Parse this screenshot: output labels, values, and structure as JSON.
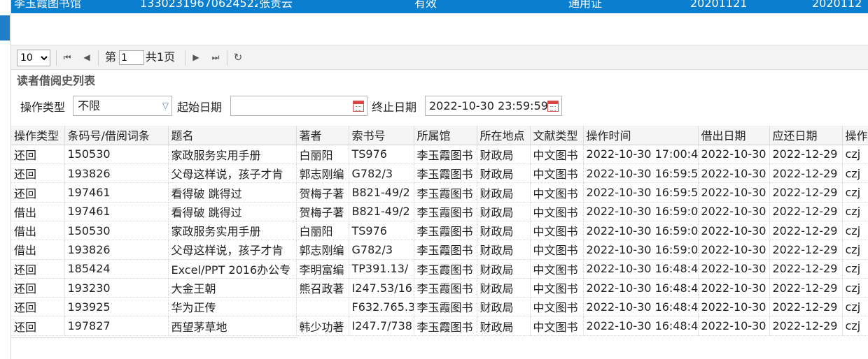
{
  "reader_row": {
    "library": "李玉霞图书馆",
    "id_number": "13302319670624522",
    "name": "张贵云",
    "status": "有效",
    "card_type": "通用证",
    "date1": "20201121",
    "date2": "2020112"
  },
  "pager": {
    "page_size": "10",
    "page_prefix": "第",
    "current_page": "1",
    "total_pages": "共1页",
    "icons": [
      "first-page-icon",
      "prev-page-icon",
      "next-page-icon",
      "last-page-icon",
      "refresh-icon"
    ]
  },
  "section_title": "读者借阅史列表",
  "filters": {
    "op_type_label": "操作类型",
    "op_type_value": "不限",
    "start_date_label": "起始日期",
    "start_date_value": "",
    "end_date_label": "终止日期",
    "end_date_value": "2022-10-30 23:59:59"
  },
  "table": {
    "columns": [
      "操作类型",
      "条码号/借阅词条",
      "题名",
      "著者",
      "索书号",
      "所属馆",
      "所在地点",
      "文献类型",
      "操作时间",
      "借出日期",
      "应还日期",
      "操作"
    ],
    "rows": [
      [
        "还回",
        "150530",
        "家政服务实用手册",
        "白丽阳",
        "TS976",
        "李玉霞图书",
        "财政局",
        "中文图书",
        "2022-10-30 17:00:4",
        "2022-10-30",
        "2022-12-29",
        "czj"
      ],
      [
        "还回",
        "193826",
        "父母这样说，孩子才肯",
        "郭志刚编",
        "G782/3",
        "李玉霞图书",
        "财政局",
        "中文图书",
        "2022-10-30 16:59:5",
        "2022-10-30",
        "2022-12-29",
        "czj"
      ],
      [
        "还回",
        "197461",
        "看得破 跳得过",
        "贺梅子著",
        "B821-49/2",
        "李玉霞图书",
        "财政局",
        "中文图书",
        "2022-10-30 16:59:5",
        "2022-10-30",
        "2022-12-29",
        "czj"
      ],
      [
        "借出",
        "197461",
        "看得破 跳得过",
        "贺梅子著",
        "B821-49/2",
        "李玉霞图书",
        "财政局",
        "中文图书",
        "2022-10-30 16:59:0",
        "2022-10-30",
        "2022-12-29",
        "czj"
      ],
      [
        "借出",
        "150530",
        "家政服务实用手册",
        "白丽阳",
        "TS976",
        "李玉霞图书",
        "财政局",
        "中文图书",
        "2022-10-30 16:59:0",
        "2022-10-30",
        "2022-12-29",
        "czj"
      ],
      [
        "借出",
        "193826",
        "父母这样说，孩子才肯",
        "郭志刚编",
        "G782/3",
        "李玉霞图书",
        "财政局",
        "中文图书",
        "2022-10-30 16:59:0",
        "2022-10-30",
        "2022-12-29",
        "czj"
      ],
      [
        "还回",
        "185424",
        "Excel/PPT 2016办公专",
        "李明富编",
        "TP391.13/",
        "李玉霞图书",
        "财政局",
        "中文图书",
        "2022-10-30 16:48:4",
        "2022-10-30",
        "2022-12-29",
        "czj"
      ],
      [
        "还回",
        "193230",
        "大金王朝",
        "熊召政著",
        "I247.53/16",
        "李玉霞图书",
        "财政局",
        "中文图书",
        "2022-10-30 16:48:4",
        "2022-10-30",
        "2022-12-29",
        "czj"
      ],
      [
        "还回",
        "193925",
        "华为正传",
        "",
        "F632.765.3",
        "李玉霞图书",
        "财政局",
        "中文图书",
        "2022-10-30 16:48:4",
        "2022-10-30",
        "2022-12-29",
        "czj"
      ],
      [
        "还回",
        "197827",
        "西望茅草地",
        "韩少功著",
        "I247.7/738",
        "李玉霞图书",
        "财政局",
        "中文图书",
        "2022-10-30 16:48:4",
        "2022-10-30",
        "2022-12-29",
        "czj"
      ]
    ]
  }
}
